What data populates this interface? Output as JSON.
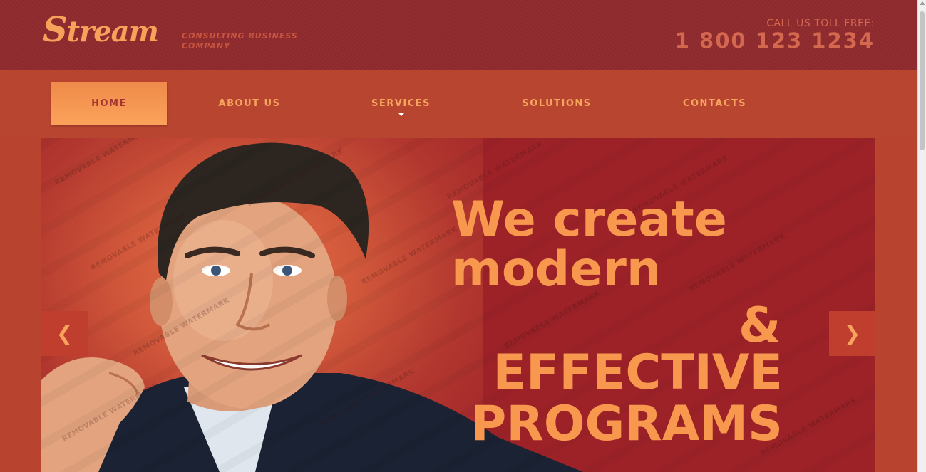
{
  "header": {
    "logo_first": "S",
    "logo_rest": "tream",
    "tagline": "CONSULTING BUSINESS COMPANY",
    "call_label": "CALL US TOLL FREE:",
    "phone": "1 800 123 1234"
  },
  "nav": {
    "items": [
      {
        "label": "HOME",
        "active": true
      },
      {
        "label": "ABOUT US",
        "active": false
      },
      {
        "label": "SERVICES",
        "active": false,
        "has_dropdown": true
      },
      {
        "label": "SOLUTIONS",
        "active": false
      },
      {
        "label": "CONTACTS",
        "active": false
      }
    ]
  },
  "slider": {
    "line1": "We create",
    "line2": "modern",
    "amp": "&",
    "line3": "EFFECTIVE",
    "line4": "PROGRAMS",
    "prev_icon": "❮",
    "next_icon": "❯",
    "watermark": "REMOVABLE WATERMARK"
  },
  "colors": {
    "header_bg": "#8f2a2e",
    "nav_bg": "#b84530",
    "accent": "#f7984e",
    "slider_bg": "#9d2228"
  }
}
